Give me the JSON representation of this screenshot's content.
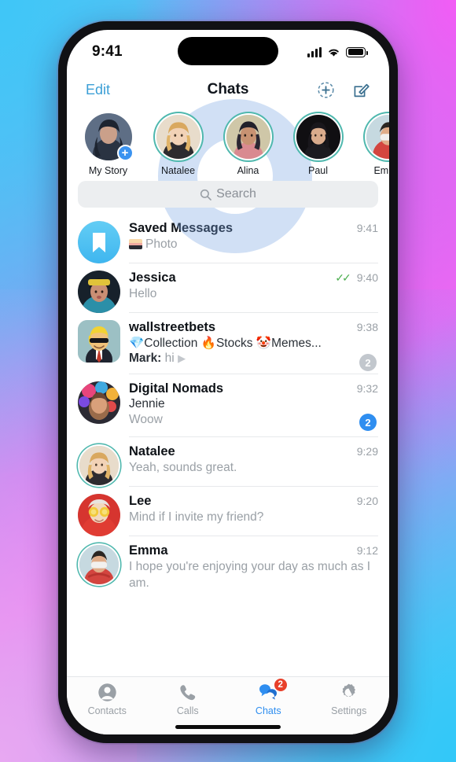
{
  "status_bar": {
    "time": "9:41",
    "signal_icon": "cellular-bars-icon",
    "wifi_icon": "wifi-icon",
    "battery_icon": "battery-icon"
  },
  "nav": {
    "edit_label": "Edit",
    "title": "Chats",
    "add_story_icon": "add-story-icon",
    "compose_icon": "compose-icon"
  },
  "stories": [
    {
      "name": "My Story",
      "has_ring": false,
      "has_plus": true
    },
    {
      "name": "Natalee",
      "has_ring": true,
      "has_plus": false
    },
    {
      "name": "Alina",
      "has_ring": true,
      "has_plus": false
    },
    {
      "name": "Paul",
      "has_ring": true,
      "has_plus": false
    },
    {
      "name": "Emma",
      "has_ring": true,
      "has_plus": false
    }
  ],
  "search": {
    "placeholder": "Search",
    "icon": "search-icon"
  },
  "chats": [
    {
      "name": "Saved Messages",
      "time": "9:41",
      "preview": "Photo",
      "has_photo_thumb": true,
      "avatar_kind": "saved-bookmark"
    },
    {
      "name": "Jessica",
      "time": "9:40",
      "preview": "Hello",
      "read_ticks": "✓✓",
      "avatar_kind": "photo-jessica"
    },
    {
      "name": "wallstreetbets",
      "time": "9:38",
      "topics": "💎Collection 🔥Stocks 🤡Memes...",
      "mark_sender": "Mark:",
      "mark_text": "hi",
      "badge": "2",
      "badge_color": "gray",
      "avatar_kind": "photo-wsb"
    },
    {
      "name": "Digital Nomads",
      "time": "9:32",
      "sender": "Jennie",
      "preview": "Woow",
      "badge": "2",
      "badge_color": "blue",
      "avatar_kind": "photo-nomads"
    },
    {
      "name": "Natalee",
      "time": "9:29",
      "preview": "Yeah, sounds great.",
      "avatar_kind": "photo-natalee",
      "has_ring": true
    },
    {
      "name": "Lee",
      "time": "9:20",
      "preview": "Mind if I invite my friend?",
      "avatar_kind": "photo-lee"
    },
    {
      "name": "Emma",
      "time": "9:12",
      "preview": "I hope you're enjoying your day as much as I am.",
      "avatar_kind": "photo-emma",
      "has_ring": true
    }
  ],
  "tabs": [
    {
      "label": "Contacts",
      "icon": "contacts-icon",
      "active": false
    },
    {
      "label": "Calls",
      "icon": "phone-icon",
      "active": false
    },
    {
      "label": "Chats",
      "icon": "chats-bubbles-icon",
      "active": true,
      "badge": "2"
    },
    {
      "label": "Settings",
      "icon": "gear-icon",
      "active": false
    }
  ],
  "colors": {
    "accent_blue": "#2f8ef0",
    "story_ring": "#4fb8ae",
    "badge_red": "#e8402a",
    "tick_green": "#4caf50",
    "edit_blue": "#3b9fd6"
  }
}
